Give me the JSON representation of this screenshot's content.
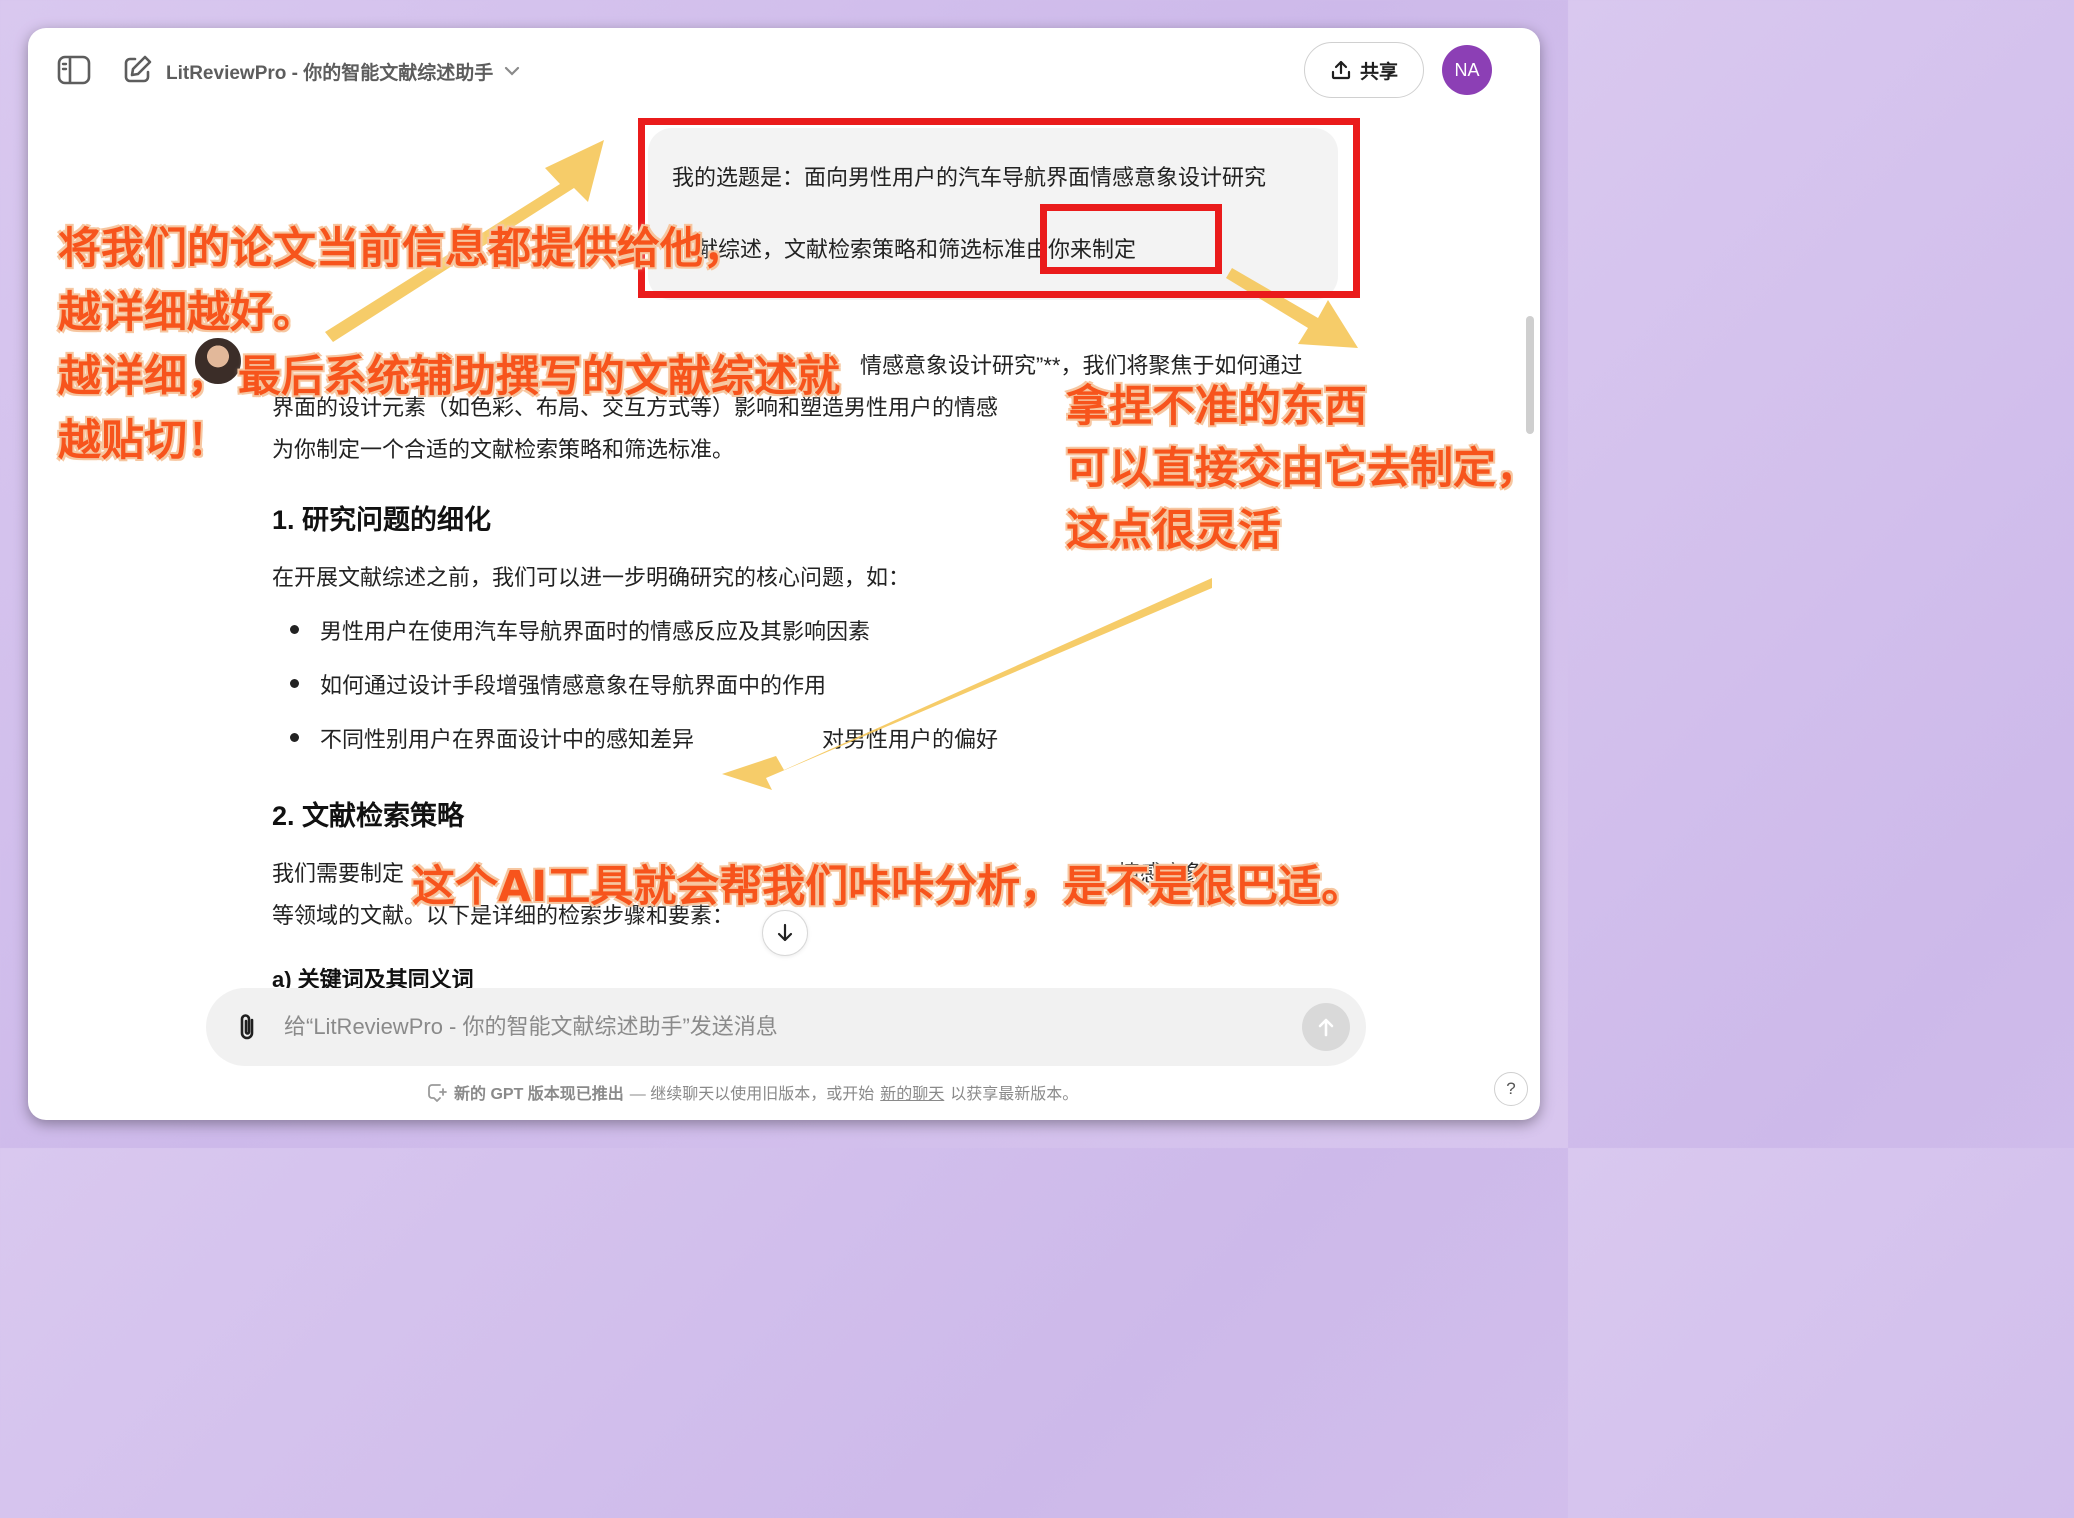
{
  "header": {
    "title": "LitReviewPro - 你的智能文献综述助手",
    "share_label": "共享",
    "avatar_initials": "NA",
    "avatar_color": "#8c3fb5"
  },
  "user_message": {
    "line1": "我的选题是：面向男性用户的汽车导航界面情感意象设计研究",
    "line2": "献综述，文献检索策略和筛选标准由你来制定"
  },
  "assistant": {
    "intro_line1": "情感意象设计研究”**，我们将聚焦于如何通过",
    "intro_line2": "界面的设计元素（如色彩、布局、交互方式等）影响和塑造男性用户的情感",
    "intro_line3": "为你制定一个合适的文献检索策略和筛选标准。",
    "section1_title": "1. 研究问题的细化",
    "section1_lead": "在开展文献综述之前，我们可以进一步明确研究的核心问题，如：",
    "section1_bullets": [
      "男性用户在使用汽车导航界面时的情感反应及其影响因素",
      "如何通过设计手段增强情感意象在导航界面中的作用",
      "不同性别用户在界面设计中的感知差异",
      "对男性用户的偏好"
    ],
    "section2_title": "2. 文献检索策略",
    "section2_line1": "我们需要制定",
    "section2_line1b": "情感意象",
    "section2_line2": "等领域的文献。以下是详细的检索步骤和要素：",
    "section2a_title": "a) 关键词及其同义词"
  },
  "composer": {
    "placeholder": "给“LitReviewPro - 你的智能文献综述助手”发送消息"
  },
  "footer": {
    "bold": "新的 GPT 版本现已推出",
    "text_before_link": "— 继续聊天以使用旧版本，或开始",
    "link": "新的聊天",
    "text_after_link": "以获享最新版本。",
    "help": "?"
  },
  "annotations": {
    "left_line1": "将我们的论文当前信息都提供给他，",
    "left_line2": "越详细越好。",
    "left_line3a": "越详细，",
    "left_line3b": "最后系统辅助撰写的文献综述就",
    "left_line4": "越贴切！",
    "right_line1": "拿捏不准的东西",
    "right_line2": "可以直接交由它去制定，",
    "right_line3": "这点很灵活",
    "bottom_line": "这个AI工具就会帮我们咔咔分析，是不是很巴适。",
    "highlight_color": "#f7541c",
    "arrow_color": "#f5c85c",
    "box_color": "#ea1b1b"
  }
}
